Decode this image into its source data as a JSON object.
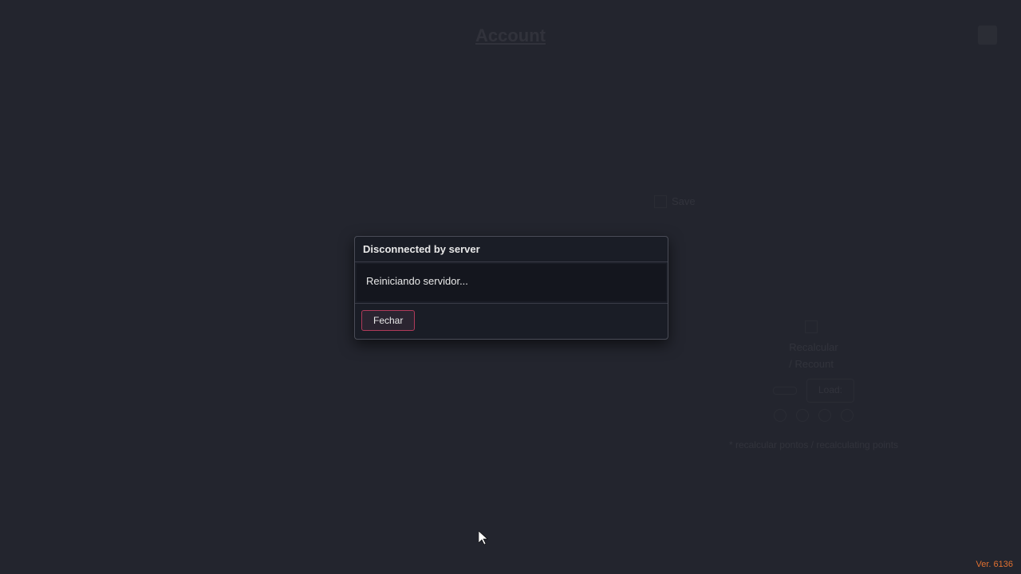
{
  "background": {
    "title": "Account",
    "panel": {
      "saveLabel": "Save",
      "loadLabel": "Load:",
      "recalcLabel": "Recalcular / Recount",
      "note": "* recalcular pontos / recalculating points"
    }
  },
  "modal": {
    "title": "Disconnected by server",
    "message": "Reiniciando servidor...",
    "closeLabel": "Fechar"
  },
  "version": "Ver. 6136"
}
